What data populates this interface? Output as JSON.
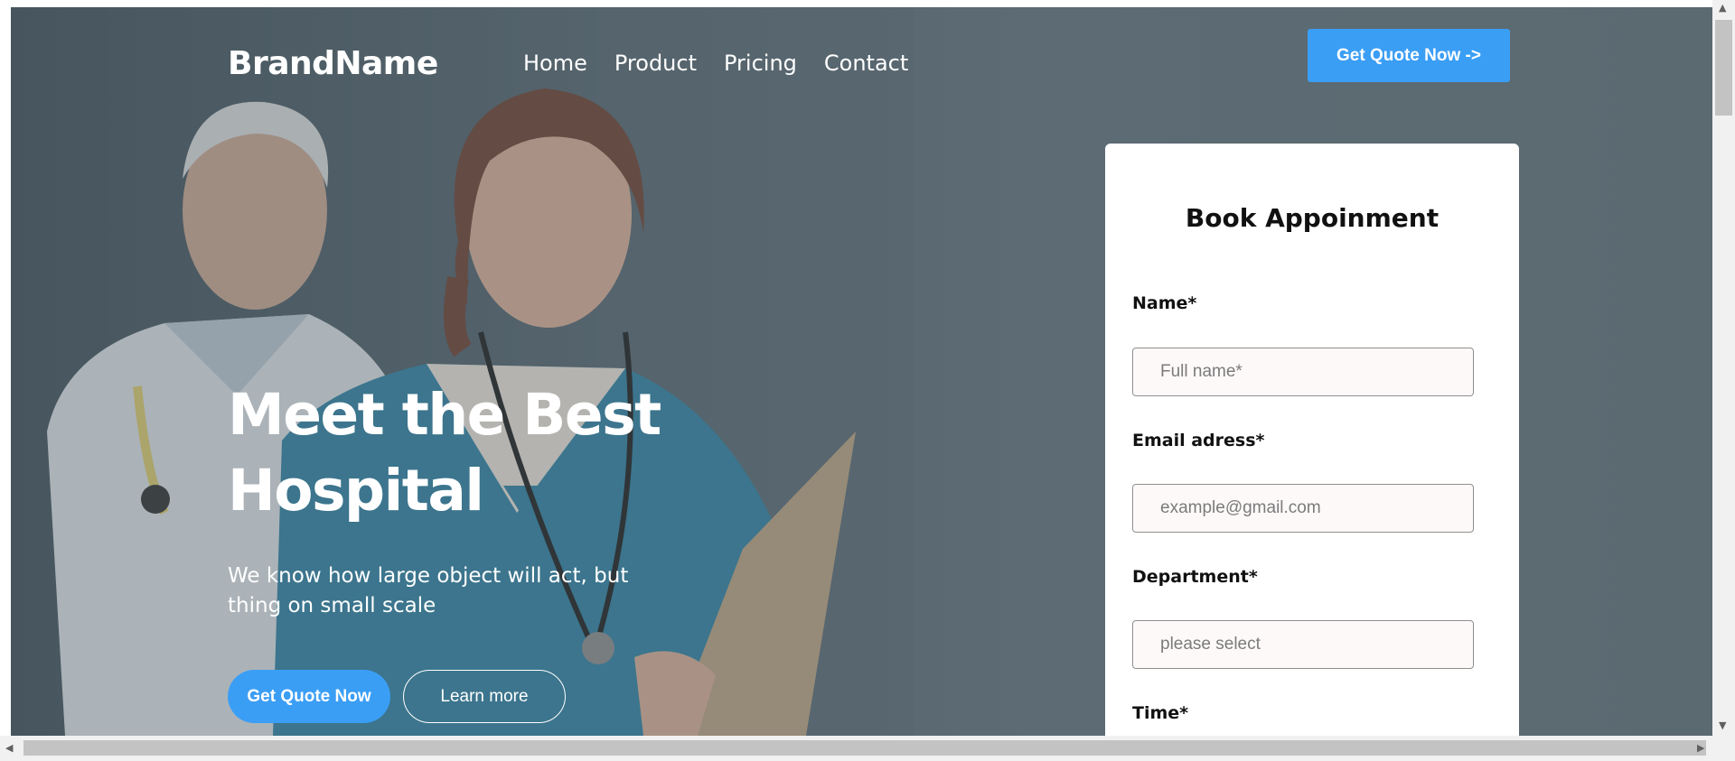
{
  "nav": {
    "brand": "BrandName",
    "links": [
      "Home",
      "Product",
      "Pricing",
      "Contact"
    ],
    "cta": "Get Quote Now ->"
  },
  "hero": {
    "headline": "Meet the Best Hospital",
    "subtitle": "We know how large object will act, but thing on small scale",
    "primary_button": "Get Quote Now",
    "secondary_button": "Learn more"
  },
  "form": {
    "title": "Book Appoinment",
    "name_label": "Name*",
    "name_placeholder": "Full name*",
    "email_label": "Email adress*",
    "email_placeholder": "example@gmail.com",
    "department_label": "Department*",
    "department_placeholder": "please select",
    "time_label": "Time*"
  },
  "colors": {
    "accent": "#3b9ef5",
    "hero_overlay": "#55646d"
  },
  "icons": {
    "scroll_up": "triangle-up",
    "scroll_down": "triangle-down",
    "scroll_left": "triangle-left",
    "scroll_right": "triangle-right"
  }
}
